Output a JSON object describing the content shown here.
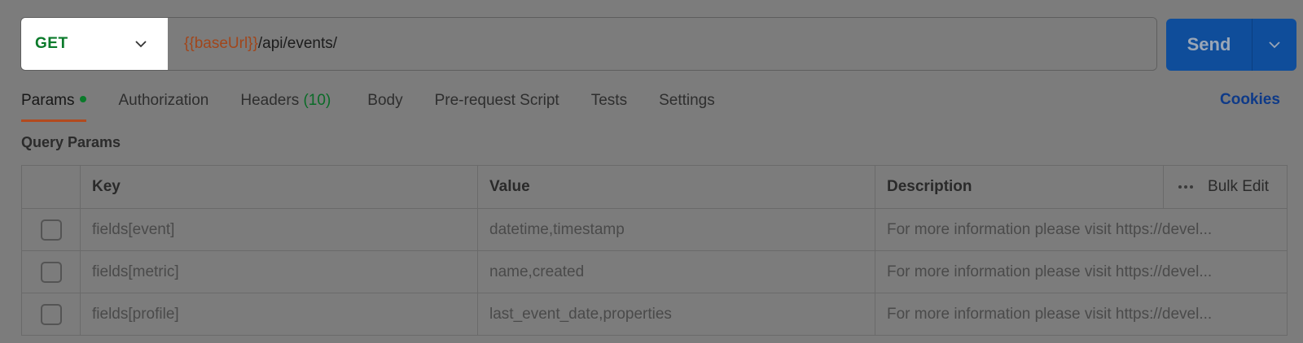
{
  "request": {
    "method": "GET",
    "url_variable": "{{baseUrl}}",
    "url_path": "/api/events/"
  },
  "send": {
    "label": "Send"
  },
  "tabs": [
    {
      "label": "Params",
      "active": true,
      "has_dot": true
    },
    {
      "label": "Authorization"
    },
    {
      "label": "Headers",
      "count": "(10)"
    },
    {
      "label": "Body"
    },
    {
      "label": "Pre-request Script"
    },
    {
      "label": "Tests"
    },
    {
      "label": "Settings"
    }
  ],
  "cookies_label": "Cookies",
  "query_params": {
    "title": "Query Params",
    "columns": {
      "key": "Key",
      "value": "Value",
      "description": "Description",
      "bulk_edit": "Bulk Edit"
    },
    "rows": [
      {
        "key": "fields[event]",
        "value": "datetime,timestamp",
        "description": "For more information please visit https://devel..."
      },
      {
        "key": "fields[metric]",
        "value": "name,created",
        "description": "For more information please visit https://devel..."
      },
      {
        "key": "fields[profile]",
        "value": "last_event_date,properties",
        "description": "For more information please visit https://devel..."
      }
    ]
  },
  "colors": {
    "method": "#0a7a2a",
    "url_variable": "#a1461b",
    "send_button": "#0f4d9a",
    "active_tab_underline": "#b24a1f",
    "cookies_link": "#0e3a88"
  }
}
